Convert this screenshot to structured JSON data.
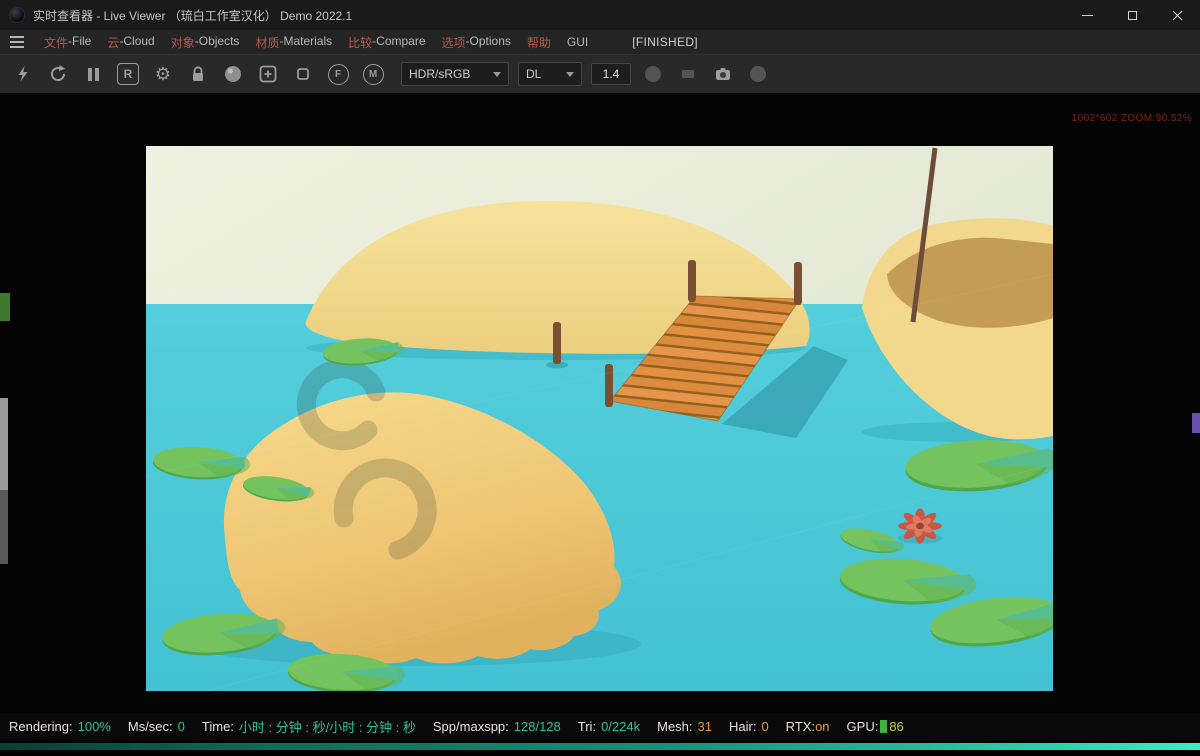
{
  "window": {
    "title": "实时查看器 - Live Viewer （琉白工作室汉化） Demo 2022.1"
  },
  "menu": {
    "items": [
      {
        "zh": "文件",
        "sep": " - ",
        "en": "File"
      },
      {
        "zh": "云",
        "sep": " - ",
        "en": "Cloud"
      },
      {
        "zh": "对象",
        "sep": " - ",
        "en": "Objects"
      },
      {
        "zh": "材质",
        "sep": " - ",
        "en": "Materials"
      },
      {
        "zh": "比较",
        "sep": " - ",
        "en": "Compare"
      },
      {
        "zh": "选项",
        "sep": " - ",
        "en": "Options"
      },
      {
        "zh": "帮助",
        "sep": "",
        "en": ""
      },
      {
        "zh": "",
        "sep": "",
        "en": "GUI"
      }
    ],
    "finished_flag": "[FINISHED]"
  },
  "icons": {
    "gear": "⚙"
  },
  "toolbar": {
    "region_label": "R",
    "focus_label": "F",
    "material_label": "M",
    "hdr_mode": "HDR/sRGB",
    "render_mode": "DL",
    "exposure": "1.4"
  },
  "viewport": {
    "overlay": "1002*602 ZOOM:90.52%"
  },
  "statusbar": {
    "items": [
      {
        "label": "Rendering:",
        "value": "100%"
      },
      {
        "label": "Ms/sec:",
        "value": "0"
      },
      {
        "label": "Time:",
        "value": "小时 : 分钟 : 秒/小时 : 分钟 : 秒"
      },
      {
        "label": "Spp/maxspp:",
        "value": "128/128"
      },
      {
        "label": "Tri:",
        "value": "0/224k"
      },
      {
        "label": "Mesh:",
        "value": "31"
      },
      {
        "label": "Hair:",
        "value": "0"
      },
      {
        "label": "RTX:",
        "value": "on"
      },
      {
        "label": "GPU:",
        "value": "86"
      }
    ]
  },
  "colors": {
    "accent_teal": "#2bc39e",
    "accent_orange": "#e69b3d",
    "accent_yellow": "#ccd53e",
    "water": "#4bc7d5",
    "sand": "#f0d586",
    "leaf_green": "#74c35e",
    "flower_red": "#c75744",
    "progress_start": "#063f36",
    "progress_end": "#3fe9c2"
  }
}
